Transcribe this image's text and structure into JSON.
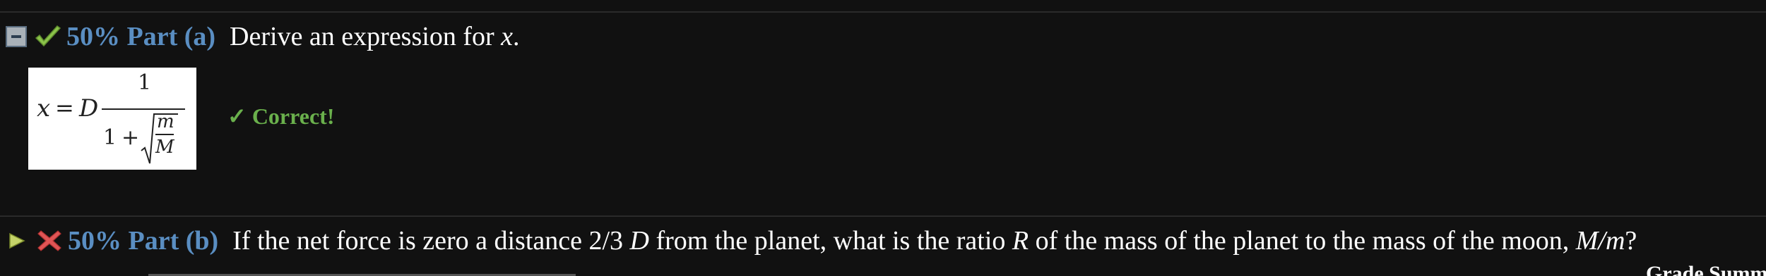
{
  "part_a": {
    "weight": "50%",
    "label": "Part (a)",
    "question_prefix": "Derive an expression for ",
    "question_var": "x",
    "question_suffix": ".",
    "answer": {
      "lhs": "x",
      "equals": "=",
      "coef": "D",
      "numerator": "1",
      "denom_one": "1",
      "denom_plus": "+",
      "root_num": "m",
      "root_den": "M"
    },
    "feedback": "✓ Correct!"
  },
  "part_b": {
    "weight": "50%",
    "label": "Part (b)",
    "question_text_1": "If the net force is zero a distance 2/3 ",
    "question_var_D": "D",
    "question_text_2": " from the planet, what is the ratio ",
    "question_var_R": "R",
    "question_text_3": " of the mass of the planet to the mass of the moon, ",
    "question_var_ratio": "M/m",
    "question_text_4": "?"
  },
  "grade_summary": "Grade Summary",
  "colors": {
    "background": "#111111",
    "part_heading": "#5a8ec2",
    "correct": "#6ab04c",
    "incorrect": "#e05555",
    "check": "#8bc34a"
  },
  "icons": {
    "collapse": "minus-square-icon",
    "expand": "play-triangle-icon",
    "correct": "checkmark-icon",
    "incorrect": "x-cross-icon"
  }
}
